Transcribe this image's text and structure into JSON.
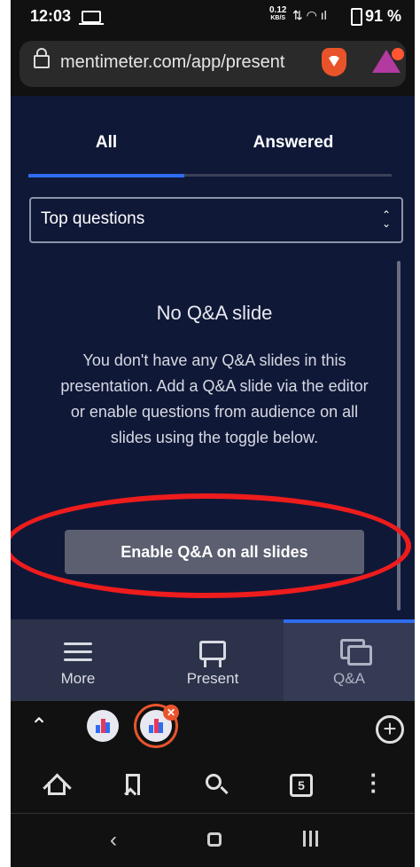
{
  "status_bar": {
    "time": "12:03",
    "net_speed_value": "0.12",
    "net_speed_unit": "KB/S",
    "battery": "91 %"
  },
  "browser": {
    "url": "mentimeter.com/app/present",
    "open_tabs_count": "5"
  },
  "page": {
    "tabs": [
      {
        "label": "All",
        "active": true
      },
      {
        "label": "Answered",
        "active": false
      }
    ],
    "sort_select": {
      "value": "Top questions"
    },
    "empty_state": {
      "title": "No Q&A slide",
      "message": "You don't have any Q&A slides in this presentation. Add a Q&A slide via the editor or enable questions from audience on all slides using the toggle below."
    },
    "enable_button_label": "Enable Q&A on all slides"
  },
  "app_nav": {
    "items": [
      {
        "label": "More",
        "icon": "hamburger-icon",
        "active": false
      },
      {
        "label": "Present",
        "icon": "presentation-icon",
        "active": false
      },
      {
        "label": "Q&A",
        "icon": "chat-bubbles-icon",
        "active": true
      }
    ]
  },
  "colors": {
    "page_background": "#101838",
    "tab_active_underline": "#2e6cf0",
    "enable_button": "#5b5f70",
    "nav_background": "#2c3249",
    "annotation_circle": "#ee1c1c",
    "brave_orange": "#e9532a"
  }
}
